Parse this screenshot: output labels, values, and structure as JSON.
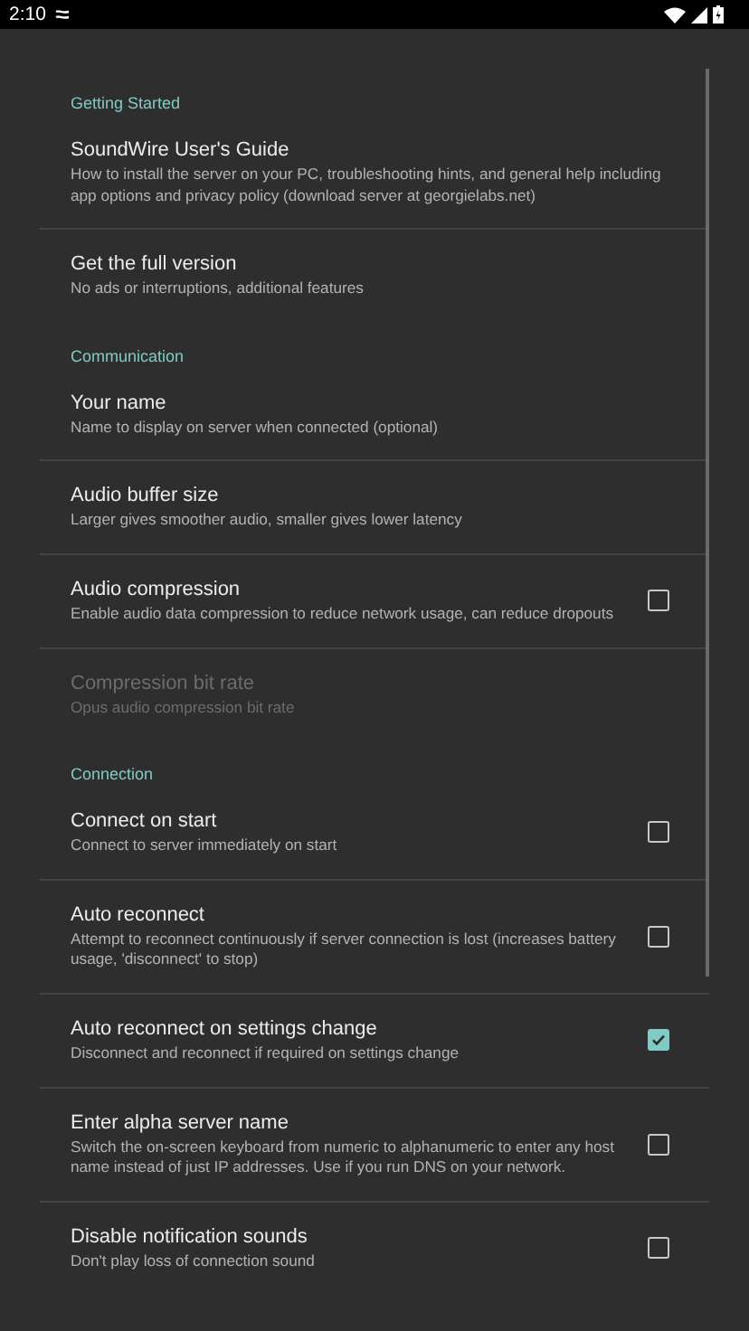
{
  "status_bar": {
    "time": "2:10"
  },
  "items": [
    {
      "kind": "header",
      "title": "Getting Started"
    },
    {
      "kind": "pref",
      "title": "SoundWire User's Guide",
      "summary": "How to install the server on your PC, troubleshooting hints, and general help including app options and privacy policy (download server at georgielabs.net)",
      "disabled": false
    },
    {
      "kind": "pref",
      "title": "Get the full version",
      "summary": "No ads or interruptions, additional features",
      "disabled": false
    },
    {
      "kind": "header",
      "title": "Communication"
    },
    {
      "kind": "pref",
      "title": "Your name",
      "summary": "Name to display on server when connected (optional)",
      "disabled": false
    },
    {
      "kind": "pref",
      "title": "Audio buffer size",
      "summary": "Larger gives smoother audio, smaller gives lower latency",
      "disabled": false
    },
    {
      "kind": "check",
      "title": "Audio compression",
      "summary": "Enable audio data compression to reduce network usage, can reduce dropouts",
      "disabled": false,
      "checked": false
    },
    {
      "kind": "pref",
      "title": "Compression bit rate",
      "summary": "Opus audio compression bit rate",
      "disabled": true
    },
    {
      "kind": "header",
      "title": "Connection"
    },
    {
      "kind": "check",
      "title": "Connect on start",
      "summary": "Connect to server immediately on start",
      "disabled": false,
      "checked": false
    },
    {
      "kind": "check",
      "title": "Auto reconnect",
      "summary": "Attempt to reconnect continuously if server connection is lost (increases battery usage, 'disconnect' to stop)",
      "disabled": false,
      "checked": false
    },
    {
      "kind": "check",
      "title": "Auto reconnect on settings change",
      "summary": "Disconnect and reconnect if required on settings change",
      "disabled": false,
      "checked": true
    },
    {
      "kind": "check",
      "title": "Enter alpha server name",
      "summary": "Switch the on-screen keyboard from numeric to alphanumeric to enter any host name instead of just IP addresses. Use if you run DNS on your network.",
      "disabled": false,
      "checked": false
    },
    {
      "kind": "check",
      "title": "Disable notification sounds",
      "summary": "Don't play loss of connection sound",
      "disabled": false,
      "checked": false
    }
  ]
}
